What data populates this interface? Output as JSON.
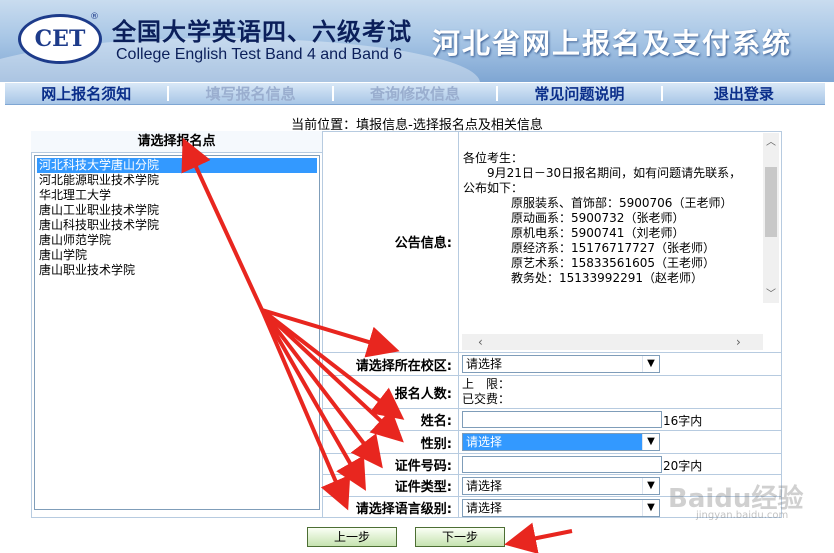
{
  "banner": {
    "logo_text": "CET",
    "logo_reg": "®",
    "title_cn": "全国大学英语四、六级考试",
    "title_en": "College English Test Band 4 and Band 6",
    "system_title": "河北省网上报名及支付系统"
  },
  "nav": {
    "items": [
      {
        "label": "网上报名须知"
      },
      {
        "label": "填写报名信息"
      },
      {
        "label": "查询修改信息"
      },
      {
        "label": "常见问题说明"
      },
      {
        "label": "退出登录"
      }
    ]
  },
  "location": "当前位置：填报信息-选择报名点及相关信息",
  "left_panel": {
    "heading": "请选择报名点",
    "schools": [
      "河北科技大学唐山分院",
      "河北能源职业技术学院",
      "华北理工大学",
      "唐山工业职业技术学院",
      "唐山科技职业技术学院",
      "唐山师范学院",
      "唐山学院",
      "唐山职业技术学院"
    ],
    "selected_index": 0
  },
  "form": {
    "notice_label": "公告信息:",
    "notice_lines": [
      "各位考生：",
      "　　9月21日－30日报名期间，如有问题请先联系，",
      "公布如下：",
      "　　　　原服装系、首饰部：5900706（王老师）",
      "　　　　原动画系：5900732（张老师）",
      "　　　　原机电系：5900741（刘老师）",
      "　　　　原经济系：15176717727（张老师）",
      "　　　　原艺术系：15833561605（王老师）",
      "　　　　教务处：15133992291（赵老师）"
    ],
    "campus_label": "请选择所在校区:",
    "campus_value": "请选择",
    "quota_label": "报名人数:",
    "quota_limit": "上　限：",
    "quota_paid": "已交费：",
    "name_label": "姓名:",
    "name_hint": "16字内",
    "gender_label": "性别:",
    "gender_value": "请选择",
    "id_number_label": "证件号码:",
    "id_number_hint": "20字内",
    "id_type_label": "证件类型:",
    "id_type_value": "请选择",
    "level_label": "请选择语言级别:",
    "level_value": "请选择"
  },
  "buttons": {
    "prev": "上一步",
    "next": "下一步"
  },
  "watermark": {
    "text": "Baidu经验",
    "sub": "jingyan.baidu.com"
  },
  "colors": {
    "nav_text": "#0a2e8a",
    "selection": "#3399ff",
    "annotation_arrow": "#e8261f"
  }
}
